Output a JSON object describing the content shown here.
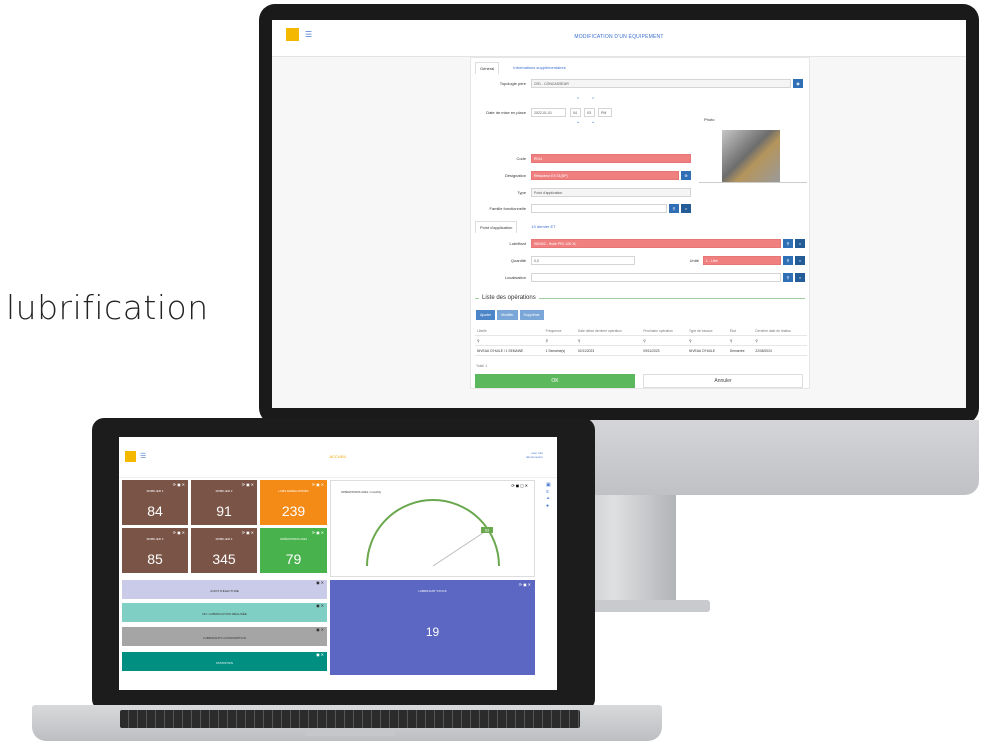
{
  "hero_label": "lubrification",
  "monitor": {
    "title": "MODIFICATION D'UN ÉQUIPEMENT",
    "tabs": [
      "Général",
      "Informations supplémentaires"
    ],
    "fields": {
      "topologie_label": "Topologie père",
      "topologie_value": "CR1 - CONCASSEUR",
      "date_label": "Date de mise en place",
      "date_value": "2022-01-01",
      "hour": "04",
      "minute": "03",
      "ampm": "PM",
      "photo_label": "Photo",
      "code_label": "Code",
      "code_value": "R014",
      "designation_label": "Désignation",
      "designation_value": "Réducteur EX 01(SP)",
      "type_label": "Type",
      "type_value": "Point d'application",
      "famille_label": "Famille fonctionnelle",
      "famille_value": ""
    },
    "subtabs": [
      "Point d'application",
      "10 dernier ET"
    ],
    "lub": {
      "lubrifiant_label": "Lubrifiant",
      "lubrifiant_value": "960402 - Huile PRL 100 XL",
      "quantite_label": "Quantité",
      "quantite_value": "0,0",
      "unite_label": "Unité",
      "unite_value": "L - Litre",
      "localisation_label": "Localisation",
      "localisation_value": ""
    },
    "ops": {
      "title": "Liste des opérations",
      "buttons": [
        "Ajouter",
        "Modifier",
        "Supprimer"
      ],
      "columns": [
        "Libellé",
        "Fréquence",
        "Date début dernière opération",
        "Prochaine opération",
        "Type de travaux",
        "État",
        "Dernière date de réalisa"
      ],
      "rows": [
        [
          "NIVEAU D'HUILE / 1 SEMAINE",
          "1 Semaine(s)",
          "02/11/2023",
          "09/11/2023",
          "NIVEAU D'HUILE",
          "Démarrée",
          "22/08/2024"
        ]
      ],
      "total": "Total: 1"
    },
    "ok_label": "OK",
    "cancel_label": "Annuler"
  },
  "laptop": {
    "title": "ACCUEIL",
    "user_line1": "user role",
    "user_line2": "déconnexion",
    "tiles": [
      {
        "label": "MOBILIER 1",
        "value": "84",
        "color": "#7a5446"
      },
      {
        "label": "MOBILIER 2",
        "value": "91",
        "color": "#7a5446"
      },
      {
        "label": "LUBS ENREGISTRÉS",
        "value": "239",
        "color": "#f38b16"
      },
      {
        "label": "MOBILIER 3",
        "value": "85",
        "color": "#7a5446"
      },
      {
        "label": "MOBILIER 4",
        "value": "345",
        "color": "#7a5446"
      },
      {
        "label": "OPÉRATIONS 2024",
        "value": "79",
        "color": "#48b34c"
      }
    ],
    "gauge_title": "OPÉRATIONS 2024 / monthly",
    "gauge_value": "63",
    "bars": [
      {
        "label": "AUDIT D'ÉLECTURE",
        "color": "#c9cbe8"
      },
      {
        "label": "NIV. LUBRIFICATION RÉALISÉE",
        "color": "#80cfc4"
      },
      {
        "label": "LUBRIFIANTS CONSOMPTION",
        "color": "#a5a5a5"
      },
      {
        "label": "STATISTICS",
        "color": "#008f80"
      }
    ],
    "big_card_label": "LUBRIFIANT STOCK",
    "big_card_value": "19"
  }
}
